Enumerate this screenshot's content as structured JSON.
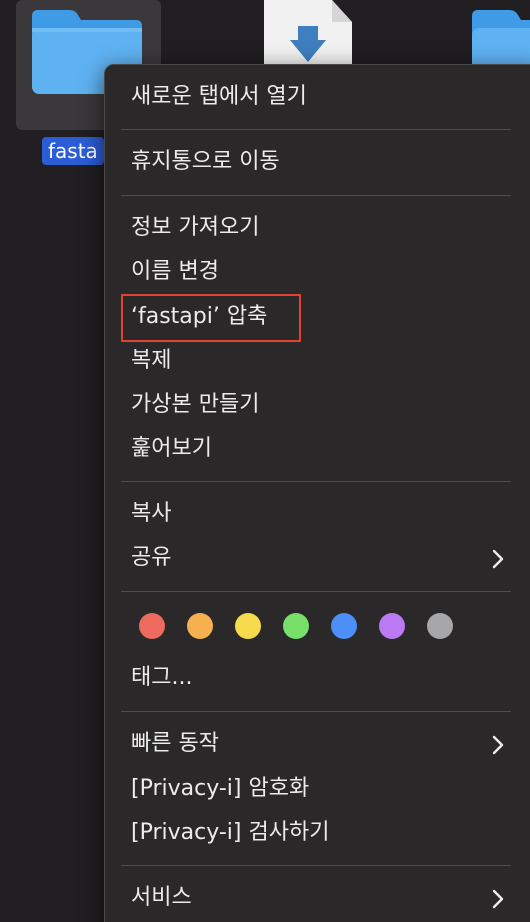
{
  "desktop": {
    "file_label": "fasta"
  },
  "menu": {
    "items": [
      {
        "label": "새로운 탭에서 열기"
      },
      {
        "label": "휴지통으로 이동"
      },
      {
        "label": "정보 가져오기"
      },
      {
        "label": "이름 변경"
      },
      {
        "label": "‘fastapi’ 압축"
      },
      {
        "label": "복제"
      },
      {
        "label": "가상본 만들기"
      },
      {
        "label": "훑어보기"
      },
      {
        "label": "복사"
      },
      {
        "label": "공유"
      },
      {
        "label": "태그..."
      },
      {
        "label": "빠른 동작"
      },
      {
        "label": "[Privacy-i] 암호화"
      },
      {
        "label": "[Privacy-i] 검사하기"
      },
      {
        "label": "서비스"
      }
    ],
    "tag_colors": [
      {
        "name": "red",
        "color": "#ec6a5e"
      },
      {
        "name": "orange",
        "color": "#f5b14f"
      },
      {
        "name": "yellow",
        "color": "#f6dc4c"
      },
      {
        "name": "green",
        "color": "#78e06a"
      },
      {
        "name": "blue",
        "color": "#4d8ef7"
      },
      {
        "name": "purple",
        "color": "#bb7af1"
      },
      {
        "name": "gray",
        "color": "#a7a6a8"
      }
    ],
    "highlight_color": "#e0432f"
  }
}
